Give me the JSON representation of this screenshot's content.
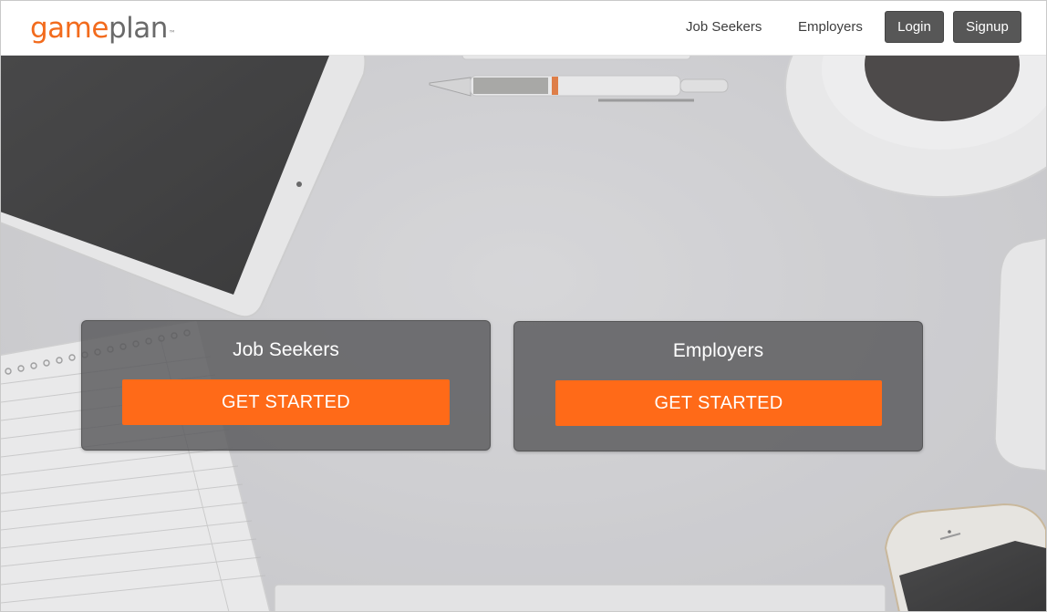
{
  "header": {
    "logo": {
      "part1": "game",
      "part2": "plan",
      "trademark": "™"
    },
    "nav": {
      "job_seekers": "Job Seekers",
      "employers": "Employers",
      "login": "Login",
      "signup": "Signup"
    }
  },
  "hero": {
    "cards": [
      {
        "title": "Job Seekers",
        "button": "GET STARTED"
      },
      {
        "title": "Employers",
        "button": "GET STARTED"
      }
    ]
  },
  "colors": {
    "brand_orange": "#ff6a18",
    "logo_orange": "#f26b1d",
    "logo_gray": "#6a6a6a",
    "nav_button": "#575757",
    "card_bg": "#58585a"
  },
  "icons": {
    "logo": "gameplan-wordmark"
  }
}
